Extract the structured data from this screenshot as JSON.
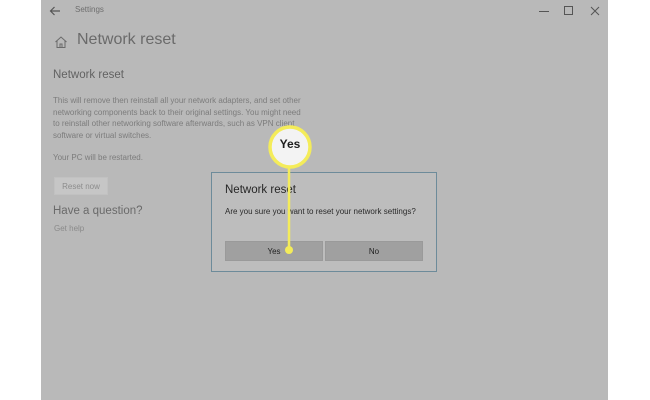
{
  "window": {
    "title": "Settings",
    "controls": [
      "minimize",
      "maximize",
      "close"
    ]
  },
  "icons": {
    "back": "back-arrow-icon",
    "home": "home-icon",
    "minimize": "minimize-icon",
    "maximize": "maximize-icon",
    "close": "close-icon"
  },
  "page": {
    "title": "Network reset",
    "section_title": "Network reset",
    "description": "This will remove then reinstall all your network adapters, and set other networking components back to their original settings. You might need to reinstall other networking software afterwards, such as VPN client software or virtual switches.",
    "restart_note": "Your PC will be restarted.",
    "reset_button": "Reset now",
    "question_title": "Have a question?",
    "help_link": "Get help"
  },
  "dialog": {
    "title": "Network reset",
    "message": "Are you sure you want to reset your network settings?",
    "yes_label": "Yes",
    "no_label": "No"
  },
  "callout": {
    "label": "Yes",
    "color": "#f4ec5a"
  },
  "colors": {
    "overlay_gray": "#b9b9b9",
    "dialog_border": "#6d8b9a",
    "button_gray": "#a0a0a0"
  }
}
